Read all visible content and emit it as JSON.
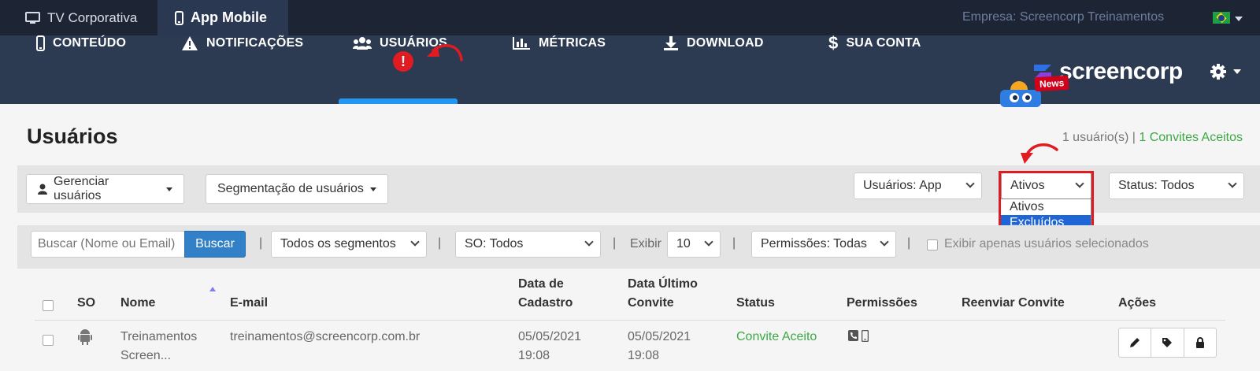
{
  "topbar": {
    "tabs": [
      {
        "label": "TV Corporativa",
        "icon": "monitor-icon"
      },
      {
        "label": "App Mobile",
        "icon": "smartphone-icon",
        "active": true
      }
    ],
    "company": "Empresa: Screencorp Treinamentos",
    "language_flag": "brazil-flag-icon"
  },
  "nav": {
    "items": [
      {
        "label": "CONTEÚDO",
        "icon": "smartphone-icon"
      },
      {
        "label": "NOTIFICAÇÕES",
        "icon": "warning-icon"
      },
      {
        "label": "USUÁRIOS",
        "icon": "users-icon",
        "active": true
      },
      {
        "label": "MÉTRICAS",
        "icon": "bar-chart-icon"
      },
      {
        "label": "DOWNLOAD",
        "icon": "download-icon"
      },
      {
        "label": "SUA CONTA",
        "icon": "dollar-icon"
      }
    ],
    "alert_badge": "!",
    "logo_text": "screencorp",
    "news_badge": "News",
    "accent_color": "#2196f3"
  },
  "page": {
    "title": "Usuários",
    "count_text": "1 usuário(s)",
    "divider": "|",
    "accepted_text": "1 Convites Aceitos"
  },
  "toolbar1": {
    "manage_label": "Gerenciar usuários",
    "segment_label": "Segmentação de usuários",
    "users_select": "Usuários: App",
    "active_select": "Ativos",
    "status_select": "Status: Todos",
    "dropdown_options": [
      "Ativos",
      "Excluídos"
    ],
    "dropdown_selected": "Excluídos"
  },
  "toolbar2": {
    "search_placeholder": "Buscar (Nome ou Email)",
    "search_button": "Buscar",
    "segments_select": "Todos os segmentos",
    "so_select": "SO: Todos",
    "exibir_label": "Exibir",
    "exibir_value": "10",
    "permissions_select": "Permissões: Todas",
    "only_selected_label": "Exibir apenas usuários selecionados",
    "separator": "|"
  },
  "table": {
    "headers": {
      "so": "SO",
      "name": "Nome",
      "email": "E-mail",
      "created_1": "Data de",
      "created_2": "Cadastro",
      "last_invite_1": "Data Último",
      "last_invite_2": "Convite",
      "status": "Status",
      "permissions": "Permissões",
      "resend": "Reenviar Convite",
      "actions": "Ações"
    },
    "rows": [
      {
        "os_icon": "android-icon",
        "name_1": "Treinamentos",
        "name_2": "Screen...",
        "email": "treinamentos@screencorp.com.br",
        "created_date": "05/05/2021",
        "created_time": "19:08",
        "invite_date": "05/05/2021",
        "invite_time": "19:08",
        "status": "Convite Aceito",
        "permission_icons": [
          "phone-icon",
          "smartphone-icon"
        ],
        "actions": [
          "pencil-icon",
          "tag-icon",
          "lock-icon"
        ]
      }
    ]
  }
}
